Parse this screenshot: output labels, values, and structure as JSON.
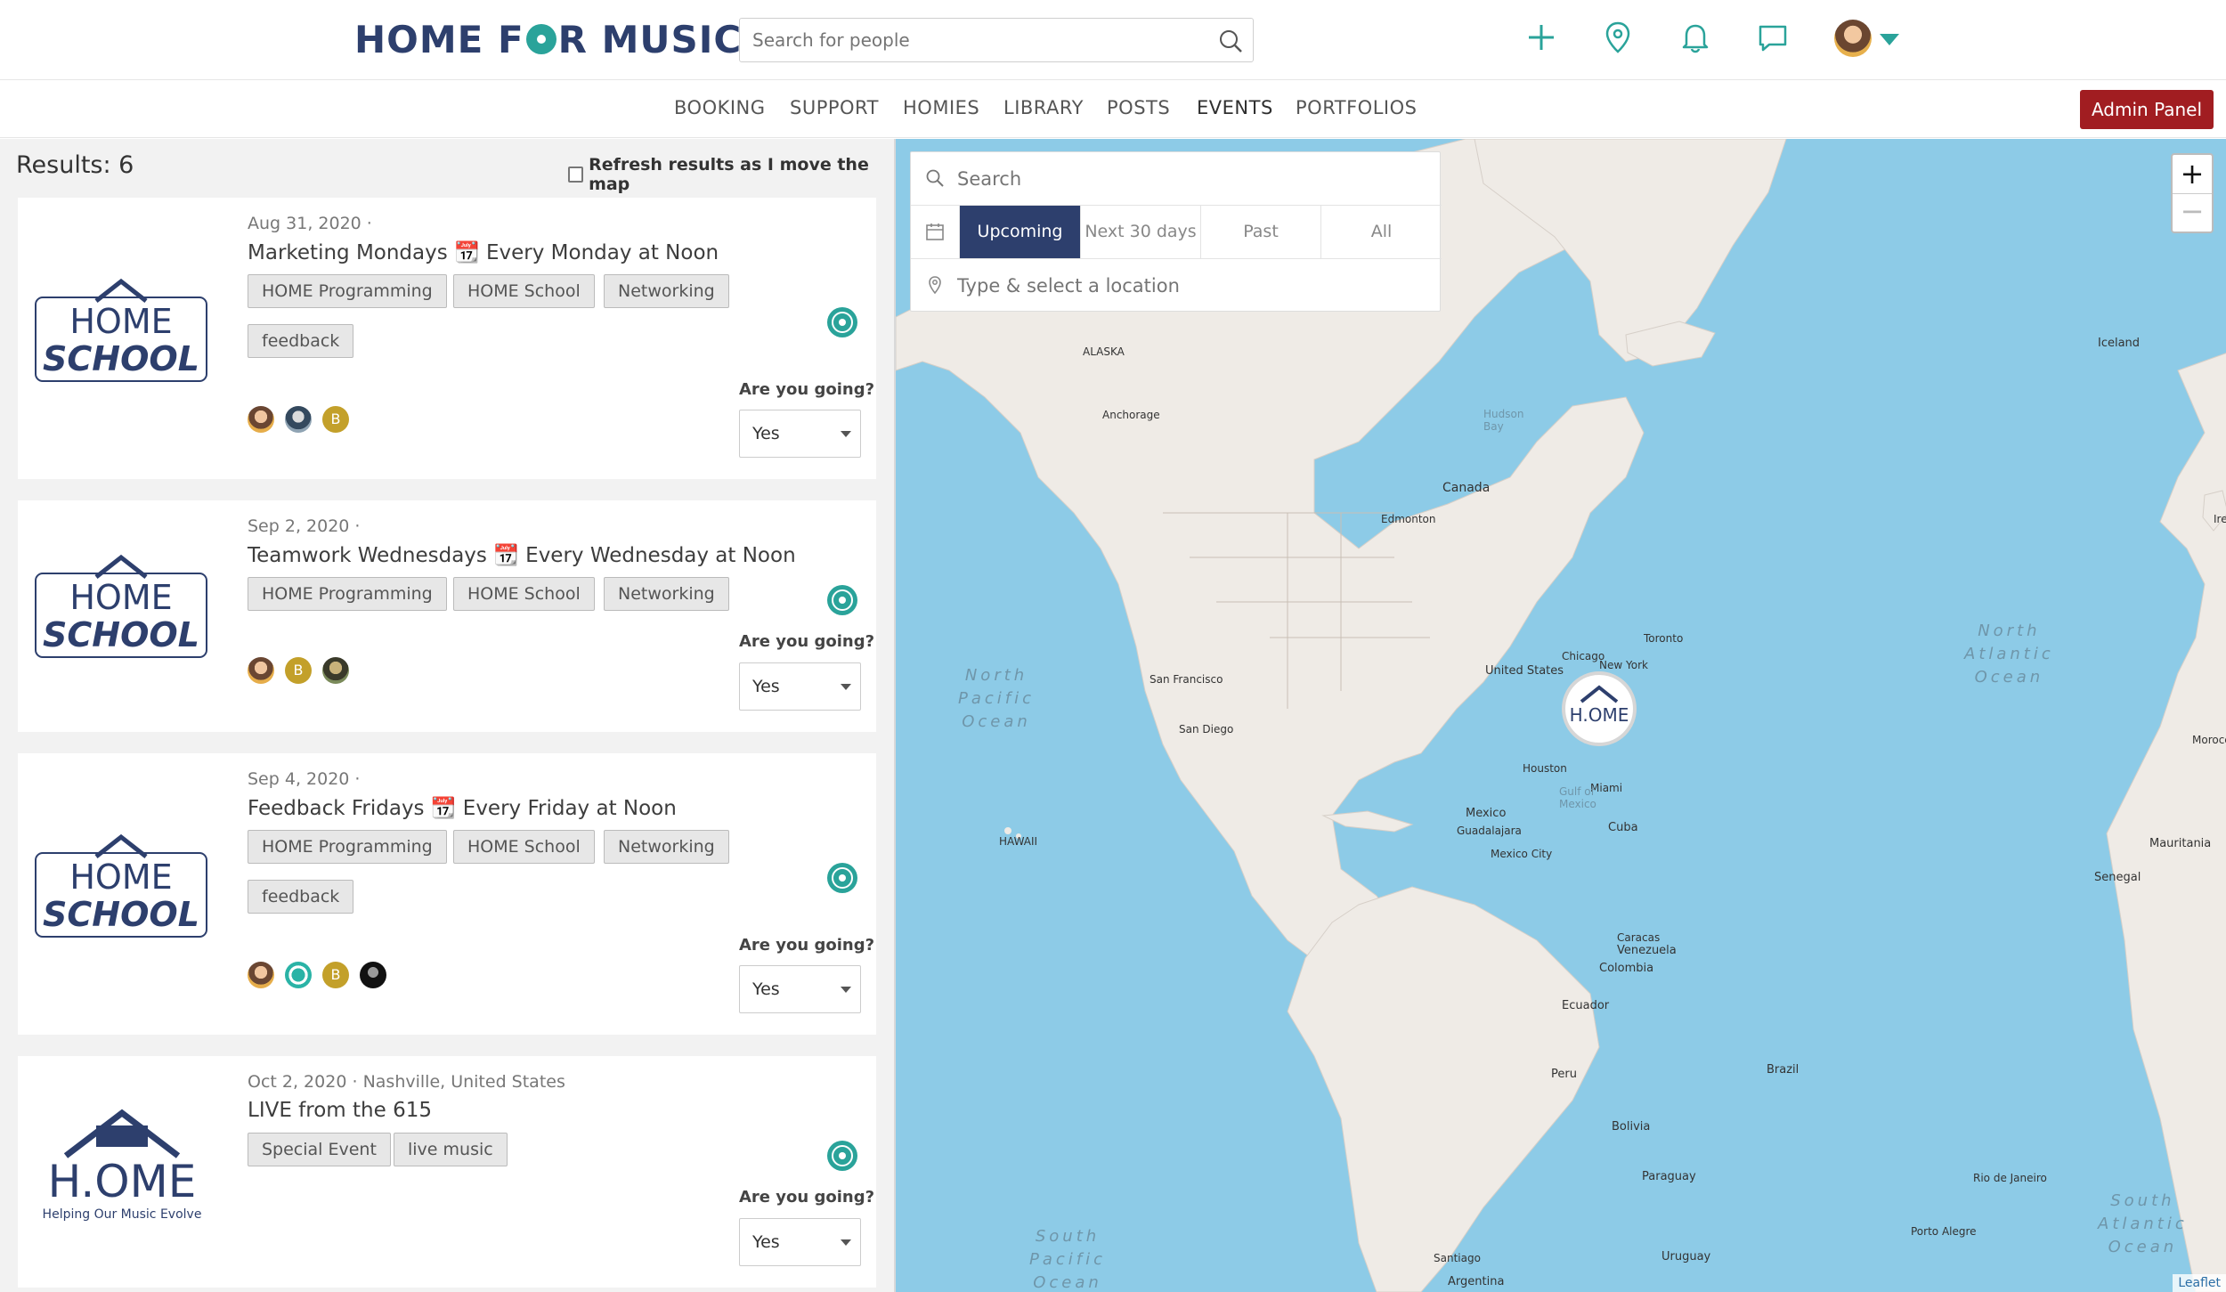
{
  "header": {
    "logo_text": "HOME FOR MUSIC",
    "search_placeholder": "Search for people",
    "icons": [
      "plus-icon",
      "location-pin-icon",
      "bell-icon",
      "chat-icon"
    ]
  },
  "nav": {
    "items": [
      "BOOKING",
      "SUPPORT",
      "HOMIES",
      "LIBRARY",
      "POSTS",
      "EVENTS",
      "PORTFOLIOS"
    ],
    "active": "EVENTS",
    "admin_label": "Admin Panel"
  },
  "results": {
    "label": "Results: 6",
    "refresh_label": "Refresh results as I move the map",
    "going_label": "Are you going?"
  },
  "events": [
    {
      "date": "Aug 31, 2020",
      "sep": "·",
      "location": "",
      "title": "Marketing Mondays 📆 Every Monday at Noon",
      "tags": [
        "HOME Programming",
        "HOME School",
        "Networking",
        "feedback"
      ],
      "going": "Yes",
      "thumb": "home-school"
    },
    {
      "date": "Sep 2, 2020",
      "sep": "·",
      "location": "",
      "title": "Teamwork Wednesdays 📆 Every Wednesday at Noon",
      "tags": [
        "HOME Programming",
        "HOME School",
        "Networking"
      ],
      "going": "Yes",
      "thumb": "home-school"
    },
    {
      "date": "Sep 4, 2020",
      "sep": "·",
      "location": "",
      "title": "Feedback Fridays 📆 Every Friday at Noon",
      "tags": [
        "HOME Programming",
        "HOME School",
        "Networking",
        "feedback"
      ],
      "going": "Yes",
      "thumb": "home-school"
    },
    {
      "date": "Oct 2, 2020",
      "sep": "·",
      "location": "Nashville, United States",
      "title": "LIVE from the 615",
      "tags": [
        "Special Event",
        "live music"
      ],
      "going": "Yes",
      "thumb": "home",
      "thumb_caption": "Helping Our Music Evolve"
    }
  ],
  "thumb_text": {
    "home_school_line1": "HOME",
    "home_school_line2": "SCHOOL",
    "home_line": "H.OME",
    "avatar_letter": "B"
  },
  "map_panel": {
    "search_placeholder": "Search",
    "filters": [
      "Upcoming",
      "Next 30 days",
      "Past",
      "All"
    ],
    "active_filter": "Upcoming",
    "location_placeholder": "Type & select a location"
  },
  "map": {
    "zoom_in": "+",
    "zoom_out": "−",
    "attribution": "Leaflet",
    "oceans": {
      "north_pacific": "North\nPacific\nOcean",
      "north_atlantic": "North\nAtlantic\nOcean",
      "south_pacific": "South\nPacific\nOcean",
      "south_atlantic": "South\nAtlantic\nOcean"
    },
    "labels": {
      "alaska": "ALASKA",
      "anchorage": "Anchorage",
      "canada": "Canada",
      "united_states": "United States",
      "mexico": "Mexico",
      "iceland": "Iceland",
      "cuba": "Cuba",
      "venezuela": "Venezuela",
      "colombia": "Colombia",
      "ecuador": "Ecuador",
      "peru": "Peru",
      "brazil": "Brazil",
      "bolivia": "Bolivia",
      "paraguay": "Paraguay",
      "uruguay": "Uruguay",
      "argentina": "Argentina",
      "hawaii": "HAWAII",
      "mauritania": "Mauritania",
      "senegal": "Senegal",
      "morocco": "Morocco",
      "ireland": "Ireland",
      "hudson_bay": "Hudson\nBay",
      "gulf_of_mexico": "Gulf of\nMexico",
      "new_york": "New York",
      "chicago": "Chicago",
      "miami": "Miami",
      "houston": "Houston",
      "san_francisco": "San Francisco",
      "san_diego": "San Diego",
      "toronto": "Toronto",
      "edmonton": "Edmonton",
      "guadalajara": "Guadalajara",
      "mexico_city": "Mexico City",
      "caracas": "Caracas",
      "santiago": "Santiago",
      "porto_alegre": "Porto Alegre",
      "rio": "Rio de Janeiro"
    }
  }
}
